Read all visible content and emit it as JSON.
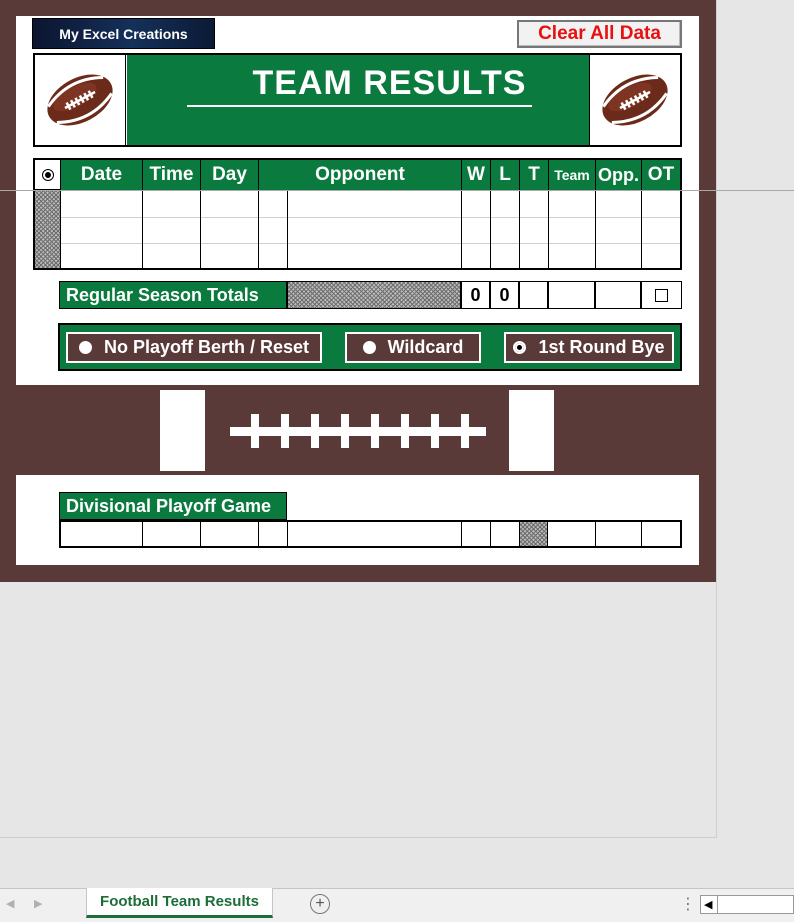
{
  "logo_button": "My Excel Creations",
  "clear_button": "Clear All Data",
  "banner": {
    "title": "TEAM RESULTS"
  },
  "table": {
    "select_icon": "radio-selected-icon",
    "headers": [
      "Date",
      "Time",
      "Day",
      "Opponent",
      "W",
      "L",
      "T",
      "Team",
      "Opp.",
      "OT"
    ]
  },
  "totals": {
    "label": "Regular Season Totals",
    "wins": "0",
    "losses": "0"
  },
  "playoff_options": [
    {
      "label": "No Playoff Berth / Reset",
      "selected": false
    },
    {
      "label": "Wildcard",
      "selected": false
    },
    {
      "label": "1st Round Bye",
      "selected": true
    }
  ],
  "divisional": {
    "label": "Divisional Playoff Game"
  },
  "sheet_tab": "Football Team Results",
  "add_sheet": "+",
  "colors": {
    "green": "#0b7a3e",
    "brown": "#5a3a38",
    "red": "#e81010"
  }
}
